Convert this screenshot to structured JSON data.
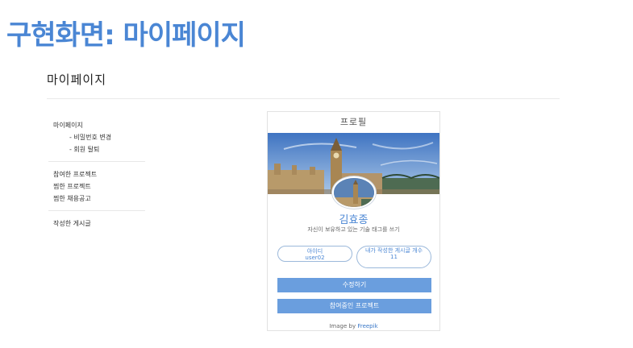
{
  "slide": {
    "title": "구현화면: 마이페이지"
  },
  "page": {
    "heading": "마이페이지"
  },
  "sidebar": {
    "group1": [
      {
        "label": "마이페이지",
        "sub": false
      },
      {
        "label": "- 비밀번호 변경",
        "sub": true
      },
      {
        "label": "- 회원 탈퇴",
        "sub": true
      }
    ],
    "group2": [
      {
        "label": "참여한 프로젝트"
      },
      {
        "label": "찜한 프로젝트"
      },
      {
        "label": "찜한 채용공고"
      }
    ],
    "group3": [
      {
        "label": "작성한 게시글"
      }
    ]
  },
  "profile": {
    "title": "프로필",
    "name": "김효종",
    "tagline": "자신이 보유하고 있는 기술 태그를 쓰기",
    "id_label": "아이디",
    "id_value": "user02",
    "posts_label": "내가 작성한 게시글 개수",
    "posts_value": "11",
    "edit_button": "수정하기",
    "projects_button": "참여중인 프로젝트",
    "credit_prefix": "Image by",
    "credit_link": "Freepik"
  }
}
